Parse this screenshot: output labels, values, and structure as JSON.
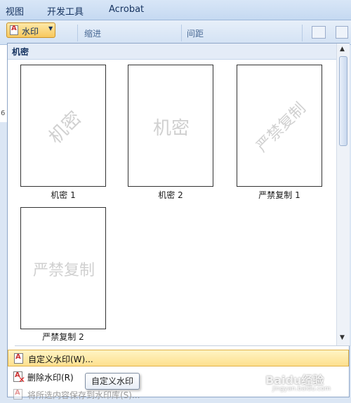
{
  "ribbon": {
    "tabs": [
      "视图",
      "开发工具",
      "Acrobat"
    ],
    "watermark_button": "水印",
    "labels": [
      "缩进",
      "间距"
    ]
  },
  "panel": {
    "section_title": "机密",
    "thumbnails": [
      {
        "caption": "机密 1",
        "watermark": "机密",
        "orientation": "diagonal"
      },
      {
        "caption": "机密 2",
        "watermark": "机密",
        "orientation": "horizontal"
      },
      {
        "caption": "严禁复制 1",
        "watermark": "严禁复制",
        "orientation": "diagonal"
      },
      {
        "caption": "严禁复制 2",
        "watermark": "严禁复制",
        "orientation": "horizontal"
      }
    ],
    "menu": [
      {
        "label": "自定义水印(W)...",
        "highlighted": true
      },
      {
        "label": "删除水印(R)"
      },
      {
        "label": "将所选内容保存到水印库(S)...",
        "disabled": true
      }
    ]
  },
  "tooltip": "自定义水印",
  "site_watermark": {
    "main": "Baidu经验",
    "sub": "jingyan.baidu.com"
  }
}
